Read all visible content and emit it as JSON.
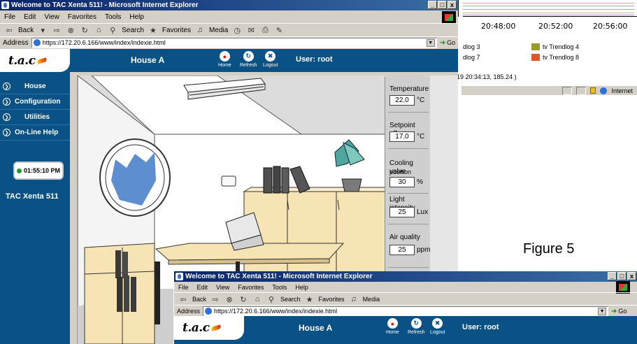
{
  "window": {
    "title": "Welcome to TAC Xenta 511! - Microsoft Internet Explorer",
    "controls": [
      "_",
      "□",
      "x"
    ]
  },
  "menu": [
    "File",
    "Edit",
    "View",
    "Favorites",
    "Tools",
    "Help"
  ],
  "toolbar": {
    "back": "Back",
    "search": "Search",
    "favorites": "Favorites",
    "media": "Media"
  },
  "address": {
    "label": "Address",
    "url": "https://172.20.6.166/www/index/indexie.html",
    "go": "Go"
  },
  "header": {
    "logo": "t.a.c",
    "title": "House A",
    "home": "Home",
    "refresh": "Refresh",
    "logout": "Logout",
    "user": "User: root"
  },
  "sidebar": {
    "items": [
      {
        "label": "House"
      },
      {
        "label": "Configuration"
      },
      {
        "label": "Utilities"
      },
      {
        "label": "On-Line Help"
      }
    ],
    "clock": "01:55:10 PM",
    "device": "TAC Xenta 511"
  },
  "values": [
    {
      "label": "Temperature",
      "label2": "",
      "value": "22.0",
      "unit": "°C"
    },
    {
      "label": "Setpoint offset",
      "label2": "",
      "value": "17.0",
      "unit": "°C"
    },
    {
      "label": "Cooling valve",
      "label2": "position",
      "value": "30",
      "unit": "%"
    },
    {
      "label": "Light intensity",
      "label2": "",
      "value": "25",
      "unit": "Lux"
    },
    {
      "label": "Air quality",
      "label2": "",
      "value": "25",
      "unit": "ppm"
    }
  ],
  "background_trend": {
    "times": [
      "20:48:00",
      "20:52:00",
      "20:56:00"
    ],
    "legend": [
      {
        "label": "dlog 3",
        "color": ""
      },
      {
        "label": "tv Trendlog 4",
        "color": "#9a9a2e"
      },
      {
        "label": "dlog 7",
        "color": ""
      },
      {
        "label": "tv Trendlog 8",
        "color": "#e0552a"
      }
    ],
    "status": "-19 20:34:13, 185.24 )",
    "zone": "Internet"
  },
  "figure_label": "Figure 5",
  "colors": {
    "tac_blue": "#0a5185",
    "title_blue": "#0a246a",
    "chrome": "#d4d0c8"
  }
}
